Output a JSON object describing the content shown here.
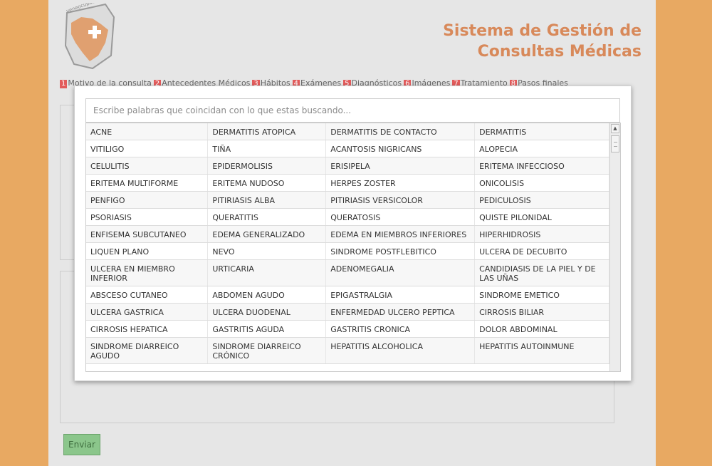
{
  "header": {
    "title_line1": "Sistema de Gestión de",
    "title_line2": "Consultas Médicas",
    "logo_text": "veneocupacional",
    "title_color": "#d8895a"
  },
  "steps": [
    {
      "num": "1",
      "label": "Motivo de la consulta"
    },
    {
      "num": "2",
      "label": "Antecedentes Médicos"
    },
    {
      "num": "3",
      "label": "Hábitos"
    },
    {
      "num": "4",
      "label": "Exámenes"
    },
    {
      "num": "5",
      "label": "Diagnósticos"
    },
    {
      "num": "6",
      "label": "Imágenes"
    },
    {
      "num": "7",
      "label": "Tratamiento"
    },
    {
      "num": "8",
      "label": "Pasos finales"
    }
  ],
  "form": {
    "submit_label": "Enviar"
  },
  "dialog": {
    "search_placeholder": "Escribe palabras que coincidan con lo que estas buscando...",
    "rows": [
      [
        "ACNE",
        "DERMATITIS ATOPICA",
        "DERMATITIS DE CONTACTO",
        "DERMATITIS"
      ],
      [
        "VITILIGO",
        "TIÑA",
        "ACANTOSIS NIGRICANS",
        "ALOPECIA"
      ],
      [
        "CELULITIS",
        "EPIDERMOLISIS",
        "ERISIPELA",
        "ERITEMA INFECCIOSO"
      ],
      [
        "ERITEMA MULTIFORME",
        "ERITEMA NUDOSO",
        "HERPES ZOSTER",
        "ONICOLISIS"
      ],
      [
        "PENFIGO",
        "PITIRIASIS ALBA",
        "PITIRIASIS VERSICOLOR",
        "PEDICULOSIS"
      ],
      [
        "PSORIASIS",
        "QUERATITIS",
        "QUERATOSIS",
        "QUISTE PILONIDAL"
      ],
      [
        "ENFISEMA SUBCUTANEO",
        "EDEMA GENERALIZADO",
        "EDEMA EN MIEMBROS INFERIORES",
        "HIPERHIDROSIS"
      ],
      [
        "LIQUEN PLANO",
        "NEVO",
        "SINDROME POSTFLEBITICO",
        "ULCERA DE DECUBITO"
      ],
      [
        "ULCERA EN MIEMBRO INFERIOR",
        "URTICARIA",
        "ADENOMEGALIA",
        "CANDIDIASIS DE LA PIEL Y DE LAS UÑAS"
      ],
      [
        "ABSCESO CUTANEO",
        "ABDOMEN AGUDO",
        "EPIGASTRALGIA",
        "SINDROME EMETICO"
      ],
      [
        "ULCERA GASTRICA",
        "ULCERA DUODENAL",
        "ENFERMEDAD ULCERO PEPTICA",
        "CIRROSIS BILIAR"
      ],
      [
        "CIRROSIS HEPATICA",
        "GASTRITIS AGUDA",
        "GASTRITIS CRONICA",
        "DOLOR ABDOMINAL"
      ],
      [
        "SINDROME DIARREICO AGUDO",
        "SINDROME DIARREICO CRÓNICO",
        "HEPATITIS ALCOHOLICA",
        "HEPATITIS AUTOINMUNE"
      ]
    ]
  }
}
